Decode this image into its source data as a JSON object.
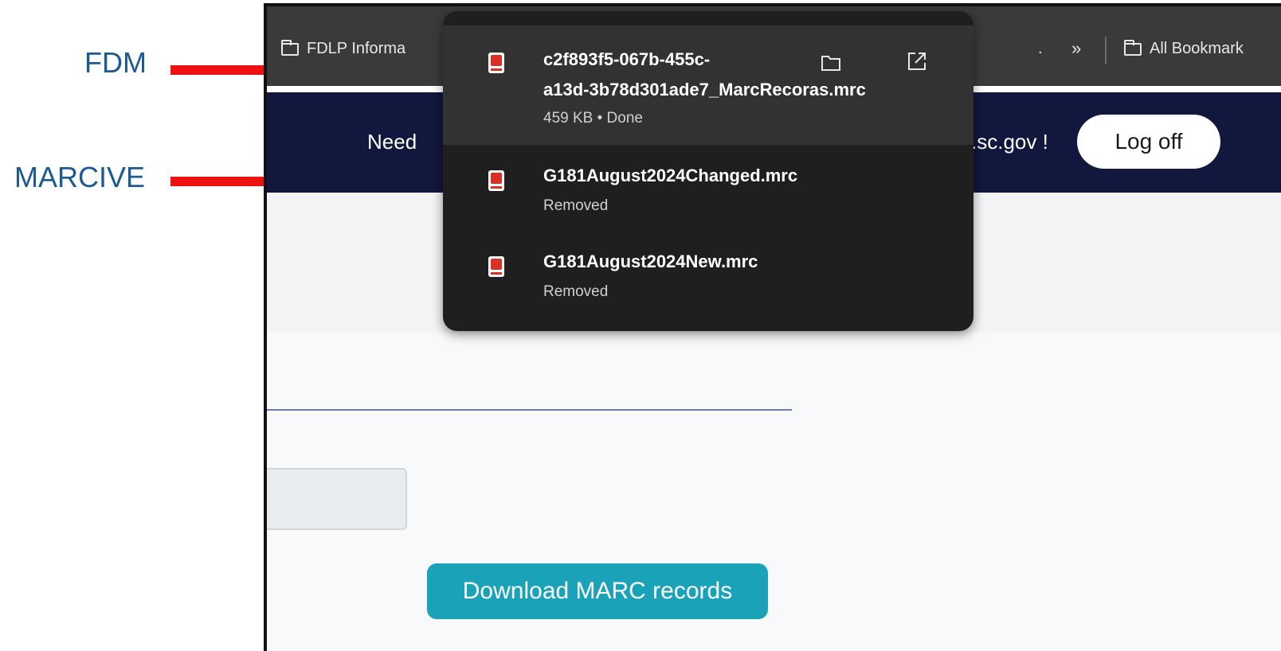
{
  "annotations": {
    "fdm": "FDM",
    "marcive": "MARCIVE",
    "arrow_color": "#ee1111"
  },
  "bookmarks": {
    "item1": "FDLP Informa",
    "ellipsis": ".",
    "chevron": "»",
    "all_bookmarks": "All Bookmark"
  },
  "banner": {
    "text_left": "Need",
    "text_right": ".sc.gov !",
    "logoff_label": "Log off"
  },
  "page": {
    "download_button_label": "Download MARC records"
  },
  "downloads": {
    "items": [
      {
        "name_line1": "c2f893f5-067b-455c-",
        "name_line2": "a13d-3b78d301ade7_MarcRecoras.mrc",
        "status": "459 KB • Done",
        "icon": "pdf-file-icon",
        "actions": [
          "folder-icon",
          "open-external-icon"
        ]
      },
      {
        "name": "G181August2024Changed.mrc",
        "status": "Removed",
        "icon": "pdf-file-icon"
      },
      {
        "name": "G181August2024New.mrc",
        "status": "Removed",
        "icon": "pdf-file-icon"
      }
    ]
  },
  "colors": {
    "annotation_text": "#1c5a96",
    "banner_bg": "#12173d",
    "popup_bg": "#1f1f1f",
    "button_teal": "#1aa3b8"
  }
}
